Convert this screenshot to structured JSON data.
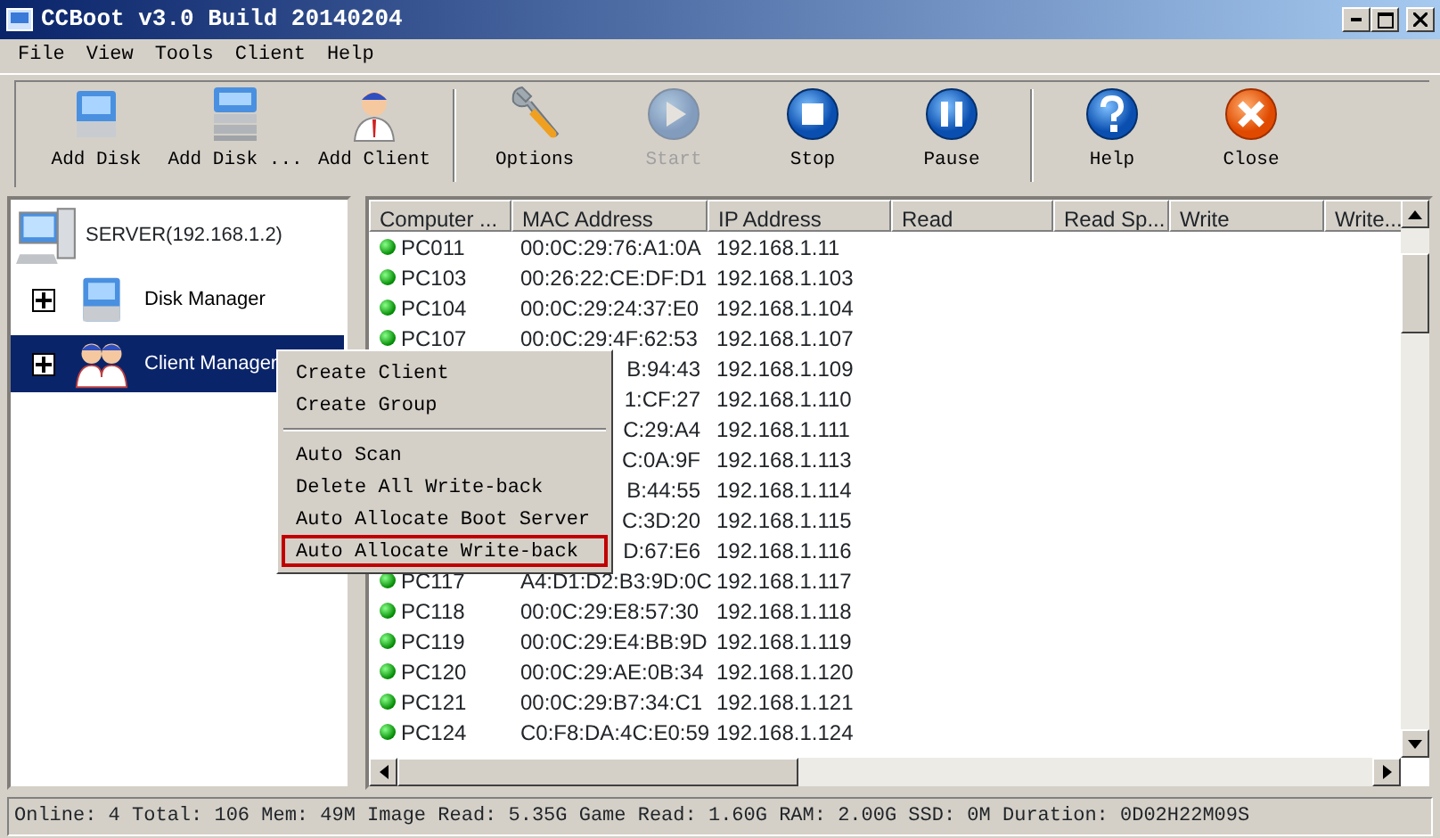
{
  "window": {
    "title": "CCBoot v3.0 Build 20140204"
  },
  "menu": [
    "File",
    "View",
    "Tools",
    "Client",
    "Help"
  ],
  "toolbar": [
    {
      "kind": "button",
      "label": "Add Disk",
      "disabled": false
    },
    {
      "kind": "button",
      "label": "Add Disk ...",
      "disabled": false
    },
    {
      "kind": "button",
      "label": "Add Client",
      "disabled": false
    },
    {
      "kind": "separator"
    },
    {
      "kind": "button",
      "label": "Options",
      "disabled": false
    },
    {
      "kind": "button",
      "label": "Start",
      "disabled": true
    },
    {
      "kind": "button",
      "label": "Stop",
      "disabled": false
    },
    {
      "kind": "button",
      "label": "Pause",
      "disabled": false
    },
    {
      "kind": "separator"
    },
    {
      "kind": "button",
      "label": "Help",
      "disabled": false
    },
    {
      "kind": "button",
      "label": "Close",
      "disabled": false
    }
  ],
  "tree": {
    "label": "SERVER(192.168.1.2)",
    "children": [
      {
        "label": "Disk Manager",
        "expanded": false,
        "selected": false
      },
      {
        "label": "Client Manager",
        "expanded": false,
        "selected": true
      }
    ]
  },
  "table": {
    "columns": [
      "Computer ...",
      "MAC Address",
      "IP Address",
      "Read",
      "Read Sp...",
      "Write",
      "Write..."
    ],
    "rows": [
      {
        "kind": "full",
        "name": "PC011",
        "mac": "00:0C:29:76:A1:0A",
        "ip": "192.168.1.11"
      },
      {
        "kind": "full",
        "name": "PC103",
        "mac": "00:26:22:CE:DF:D1",
        "ip": "192.168.1.103"
      },
      {
        "kind": "full",
        "name": "PC104",
        "mac": "00:0C:29:24:37:E0",
        "ip": "192.168.1.104"
      },
      {
        "kind": "full",
        "name": "PC107",
        "mac": "00:0C:29:4F:62:53",
        "ip": "192.168.1.107"
      },
      {
        "kind": "covered",
        "mac": "B:94:43",
        "ip": "192.168.1.109"
      },
      {
        "kind": "covered",
        "mac": "1:CF:27",
        "ip": "192.168.1.110"
      },
      {
        "kind": "covered",
        "mac": "C:29:A4",
        "ip": "192.168.1.111"
      },
      {
        "kind": "covered",
        "mac": "C:0A:9F",
        "ip": "192.168.1.113"
      },
      {
        "kind": "covered",
        "mac": "B:44:55",
        "ip": "192.168.1.114"
      },
      {
        "kind": "covered",
        "mac": "C:3D:20",
        "ip": "192.168.1.115"
      },
      {
        "kind": "covered",
        "mac": "D:67:E6",
        "ip": "192.168.1.116"
      },
      {
        "kind": "full",
        "name": "PC117",
        "mac": "A4:D1:D2:B3:9D:0C",
        "ip": "192.168.1.117"
      },
      {
        "kind": "full",
        "name": "PC118",
        "mac": "00:0C:29:E8:57:30",
        "ip": "192.168.1.118"
      },
      {
        "kind": "full",
        "name": "PC119",
        "mac": "00:0C:29:E4:BB:9D",
        "ip": "192.168.1.119"
      },
      {
        "kind": "full",
        "name": "PC120",
        "mac": "00:0C:29:AE:0B:34",
        "ip": "192.168.1.120"
      },
      {
        "kind": "full",
        "name": "PC121",
        "mac": "00:0C:29:B7:34:C1",
        "ip": "192.168.1.121"
      },
      {
        "kind": "full",
        "name": "PC124",
        "mac": "C0:F8:DA:4C:E0:59",
        "ip": "192.168.1.124"
      }
    ]
  },
  "context_menu": [
    {
      "kind": "item",
      "label": "Create Client",
      "highlighted": false
    },
    {
      "kind": "item",
      "label": "Create Group",
      "highlighted": false
    },
    {
      "kind": "separator"
    },
    {
      "kind": "item",
      "label": "Auto Scan",
      "highlighted": false
    },
    {
      "kind": "item",
      "label": "Delete All Write-back",
      "highlighted": false
    },
    {
      "kind": "item",
      "label": "Auto Allocate Boot Server",
      "highlighted": false
    },
    {
      "kind": "item",
      "label": "Auto Allocate Write-back",
      "highlighted": true
    }
  ],
  "status_bar": "Online: 4 Total: 106 Mem: 49M Image Read: 5.35G Game Read: 1.60G RAM: 2.00G SSD: 0M Duration: 0D02H22M09S"
}
